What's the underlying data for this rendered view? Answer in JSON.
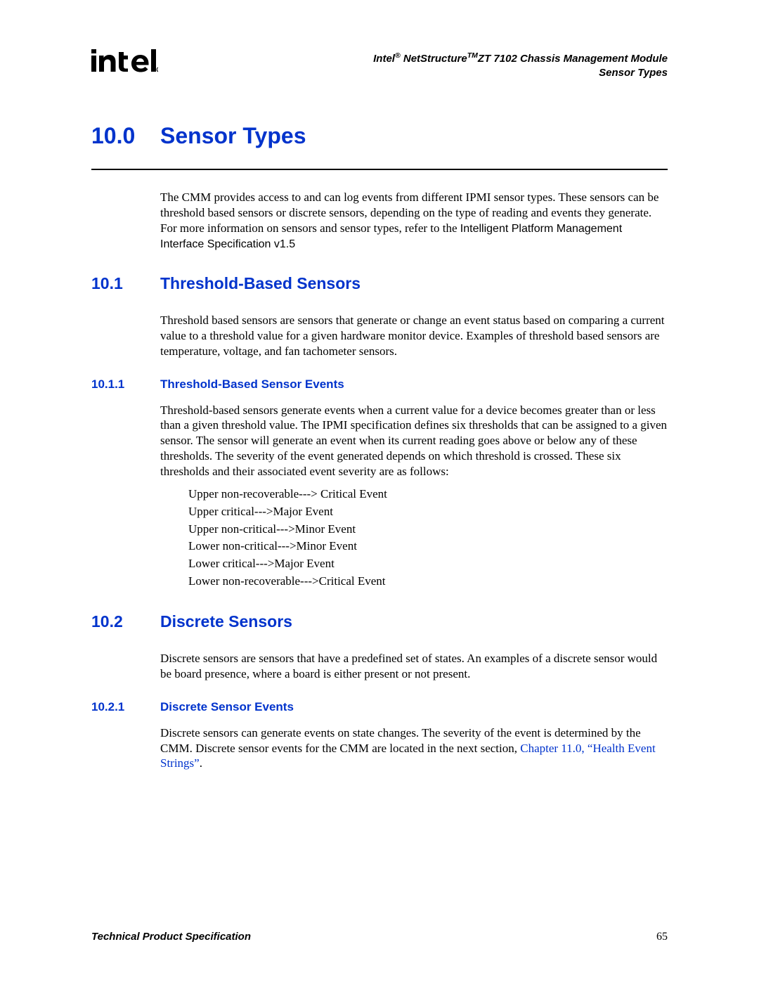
{
  "header": {
    "line1_prefix": "Intel",
    "line1_reg": "®",
    "line1_mid": " NetStructure",
    "line1_tm": "TM",
    "line1_suffix": "ZT 7102 Chassis Management Module",
    "line2": "Sensor Types"
  },
  "title": {
    "num": "10.0",
    "text": "Sensor Types"
  },
  "intro": {
    "text1": "The CMM provides access to and can log events from different IPMI sensor types. These sensors can be threshold based sensors or discrete sensors, depending on the type of reading and events they generate. For more information on sensors and sensor types, refer to the ",
    "ref": "Intelligent Platform Management Interface Specification v1.5"
  },
  "s10_1": {
    "num": "10.1",
    "title": "Threshold-Based Sensors",
    "body": "Threshold based sensors are sensors that generate or change an event status based on comparing a current value to a threshold value for a given hardware monitor device. Examples of threshold based sensors are temperature, voltage, and fan tachometer sensors."
  },
  "s10_1_1": {
    "num": "10.1.1",
    "title": "Threshold-Based Sensor Events",
    "body": "Threshold-based sensors generate events when a current value for a device becomes greater than or less than a given threshold value. The IPMI specification defines six thresholds that can be assigned to a given sensor. The sensor will generate an event when its current reading goes above or below any of these thresholds. The severity of the event generated depends on which threshold is crossed. These six thresholds and their associated event severity are as follows:",
    "list": [
      "Upper non-recoverable---> Critical Event",
      "Upper critical--->Major Event",
      "Upper non-critical--->Minor Event",
      "Lower non-critical--->Minor Event",
      "Lower critical--->Major Event",
      "Lower non-recoverable--->Critical Event"
    ]
  },
  "s10_2": {
    "num": "10.2",
    "title": "Discrete Sensors",
    "body": "Discrete sensors are sensors that have a predefined set of states. An examples of a discrete sensor would be board presence, where a board is either present or not present."
  },
  "s10_2_1": {
    "num": "10.2.1",
    "title": "Discrete Sensor Events",
    "body1": "Discrete sensors can generate events on state changes. The severity of the event is determined by the CMM. Discrete sensor events for the CMM are located in the next section, ",
    "link": "Chapter 11.0, “Health Event Strings”",
    "body2": "."
  },
  "footer": {
    "left": "Technical Product Specification",
    "right": "65"
  }
}
